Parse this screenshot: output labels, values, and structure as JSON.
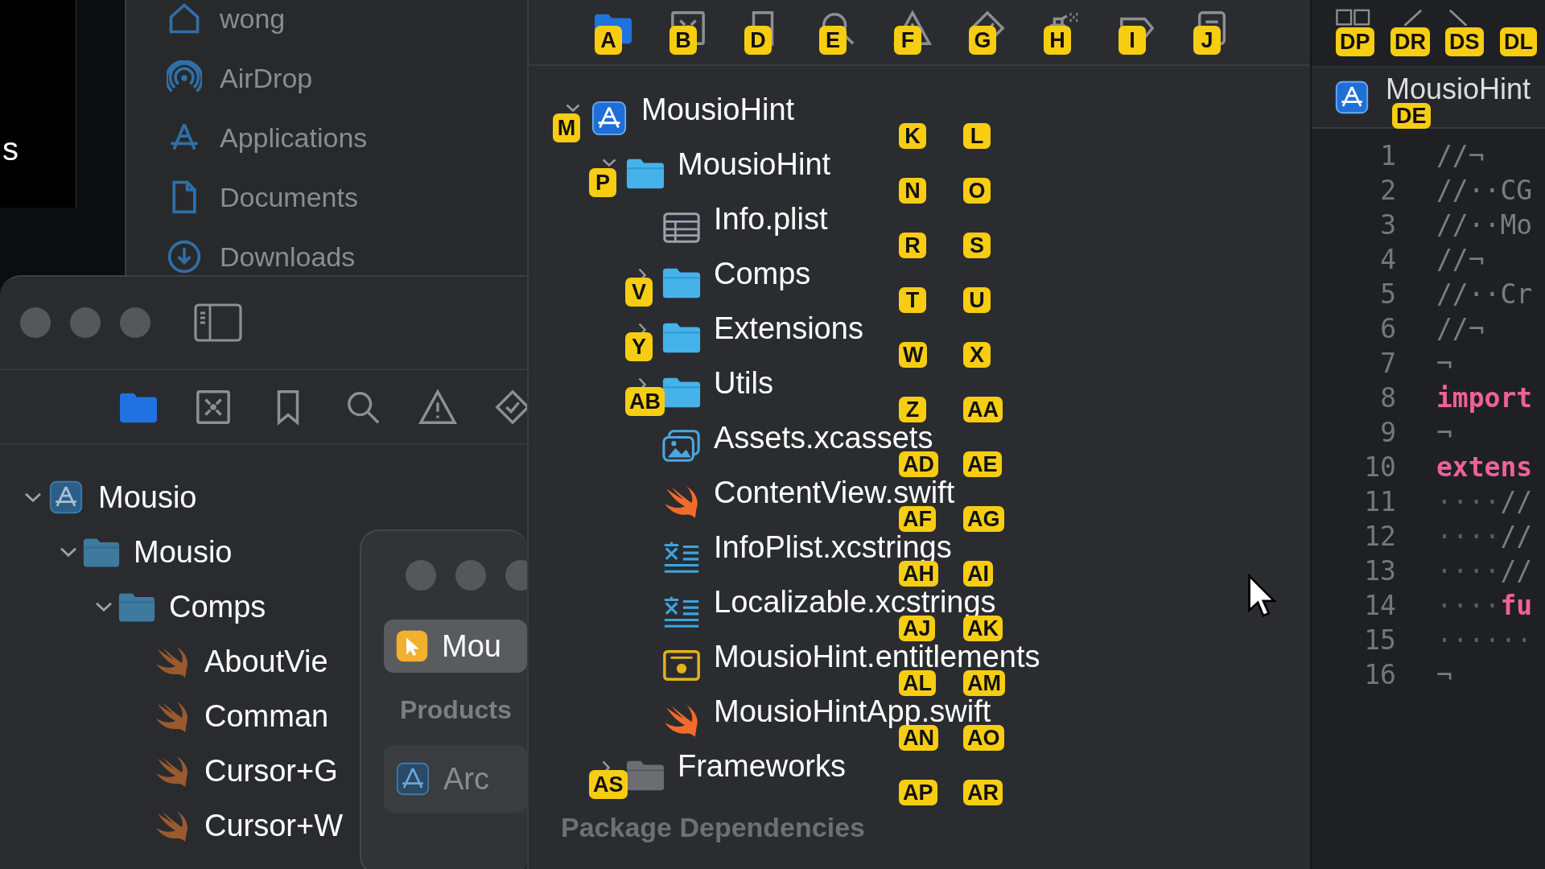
{
  "desktop_fragment": {
    "text": "s"
  },
  "finder_sidebar": {
    "items": [
      {
        "kind": "home",
        "label": "wong"
      },
      {
        "kind": "airdrop",
        "label": "AirDrop"
      },
      {
        "kind": "applications",
        "label": "Applications"
      },
      {
        "kind": "documents",
        "label": "Documents"
      },
      {
        "kind": "downloads",
        "label": "Downloads"
      }
    ]
  },
  "back_window": {
    "navigator_tabs": [
      {
        "kind": "folder",
        "selected": true
      },
      {
        "kind": "source-control",
        "selected": false
      },
      {
        "kind": "bookmark",
        "selected": false
      },
      {
        "kind": "search",
        "selected": false
      },
      {
        "kind": "warning",
        "selected": false
      },
      {
        "kind": "test",
        "selected": false
      }
    ],
    "tree": [
      {
        "kind": "project",
        "label": "Mousio",
        "expanded": true,
        "children": [
          {
            "kind": "folder",
            "label": "Mousio",
            "expanded": true,
            "children": [
              {
                "kind": "folder",
                "label": "Comps",
                "expanded": true,
                "children": [
                  {
                    "kind": "swift",
                    "label": "AboutVie"
                  },
                  {
                    "kind": "swift",
                    "label": "Comman"
                  },
                  {
                    "kind": "swift",
                    "label": "Cursor+G"
                  },
                  {
                    "kind": "swift",
                    "label": "Cursor+W"
                  }
                ]
              }
            ]
          }
        ]
      }
    ]
  },
  "scheme_popup": {
    "items": [
      {
        "kind": "app",
        "label": "Mou",
        "selected": true
      },
      {
        "kind": "header",
        "label": "Products"
      },
      {
        "kind": "archive",
        "label": "Arc",
        "selected": false
      }
    ]
  },
  "main_navigator": {
    "tabs": [
      {
        "kind": "folder",
        "hint": "A",
        "selected": true
      },
      {
        "kind": "source-control",
        "hint": "B",
        "selected": false
      },
      {
        "kind": "bookmark",
        "hint": "D",
        "selected": false
      },
      {
        "kind": "search",
        "hint": "E",
        "selected": false
      },
      {
        "kind": "warning",
        "hint": "F",
        "selected": false
      },
      {
        "kind": "test",
        "hint": "G",
        "selected": false
      },
      {
        "kind": "debug",
        "hint": "H",
        "selected": false
      },
      {
        "kind": "breakpoint",
        "hint": "I",
        "selected": false
      },
      {
        "kind": "report",
        "hint": "J",
        "selected": false
      }
    ],
    "tree": [
      {
        "kind": "project",
        "label": "MousioHint",
        "expanded": true,
        "chevron_hint": "M",
        "hints": [
          "K",
          "L"
        ],
        "children": [
          {
            "kind": "folder",
            "label": "MousioHint",
            "expanded": true,
            "chevron_hint": "P",
            "hints": [
              "N",
              "O"
            ],
            "children": [
              {
                "kind": "plist",
                "label": "Info.plist",
                "hints": [
                  "R",
                  "S"
                ]
              },
              {
                "kind": "folder",
                "label": "Comps",
                "expanded": false,
                "chevron_hint": "V",
                "hints": [
                  "T",
                  "U"
                ]
              },
              {
                "kind": "folder",
                "label": "Extensions",
                "expanded": false,
                "chevron_hint": "Y",
                "hints": [
                  "W",
                  "X"
                ]
              },
              {
                "kind": "folder",
                "label": "Utils",
                "expanded": false,
                "chevron_hint": "AB",
                "hints": [
                  "Z",
                  "AA"
                ]
              },
              {
                "kind": "assets",
                "label": "Assets.xcassets",
                "hints": [
                  "AD",
                  "AE"
                ]
              },
              {
                "kind": "swift",
                "label": "ContentView.swift",
                "hints": [
                  "AF",
                  "AG"
                ]
              },
              {
                "kind": "strings",
                "label": "InfoPlist.xcstrings",
                "hints": [
                  "AH",
                  "AI"
                ]
              },
              {
                "kind": "strings",
                "label": "Localizable.xcstrings",
                "hints": [
                  "AJ",
                  "AK"
                ]
              },
              {
                "kind": "entitlements",
                "label": "MousioHint.entitlements",
                "hints": [
                  "AL",
                  "AM"
                ]
              },
              {
                "kind": "swift",
                "label": "MousioHintApp.swift",
                "hints": [
                  "AN",
                  "AO"
                ]
              }
            ]
          },
          {
            "kind": "framework",
            "label": "Frameworks",
            "expanded": false,
            "chevron_hint": "AS",
            "hints": [
              "AP",
              "AR"
            ]
          }
        ]
      }
    ],
    "section": {
      "label": "Package Dependencies"
    }
  },
  "editor": {
    "toolbar": [
      {
        "kind": "layout",
        "hint": "DP"
      },
      {
        "kind": "back",
        "hint": "DR"
      },
      {
        "kind": "forward",
        "hint": "DS"
      },
      {
        "kind": "blank",
        "hint": "DL"
      }
    ],
    "tab": {
      "label": "MousioHint",
      "hint": "DE"
    },
    "lines": [
      {
        "number": "1",
        "code": "//¬",
        "kind": "comment"
      },
      {
        "number": "2",
        "code": "//··CG",
        "kind": "comment"
      },
      {
        "number": "3",
        "code": "//··Mo",
        "kind": "comment"
      },
      {
        "number": "4",
        "code": "//¬",
        "kind": "comment"
      },
      {
        "number": "5",
        "code": "//··Cr",
        "kind": "comment"
      },
      {
        "number": "6",
        "code": "//¬",
        "kind": "comment"
      },
      {
        "number": "7",
        "code": "¬",
        "kind": "comment"
      },
      {
        "number": "8",
        "code": "import",
        "kind": "keyword"
      },
      {
        "number": "9",
        "code": "¬",
        "kind": "comment"
      },
      {
        "number": "10",
        "code": "extens",
        "kind": "keyword"
      },
      {
        "number": "11",
        "whitespace": "····",
        "code": "//",
        "kind": "comment"
      },
      {
        "number": "12",
        "whitespace": "····",
        "code": "//",
        "kind": "comment"
      },
      {
        "number": "13",
        "whitespace": "····",
        "code": "//",
        "kind": "comment"
      },
      {
        "number": "14",
        "whitespace": "····",
        "code": "fu",
        "kind": "keyword"
      },
      {
        "number": "15",
        "whitespace": "······",
        "kind": "comment"
      },
      {
        "number": "16",
        "code": "¬",
        "kind": "comment"
      }
    ]
  }
}
